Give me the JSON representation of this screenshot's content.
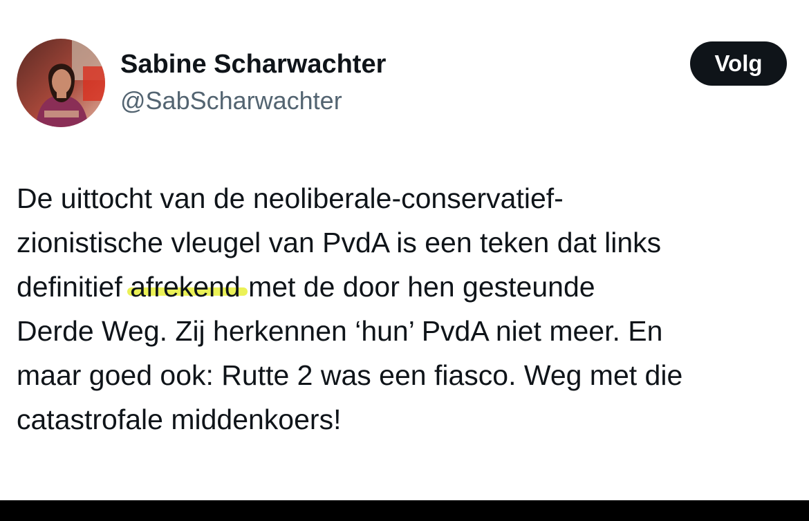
{
  "author": {
    "name": "Sabine Scharwachter",
    "handle": "@SabScharwachter"
  },
  "follow_button": {
    "label": "Volg",
    "color": "#0f1419",
    "text_color": "#ffffff"
  },
  "tweet": {
    "lines": [
      {
        "before": "De uittocht van de neoliberale-conservatief-",
        "highlight": "",
        "after": ""
      },
      {
        "before": "zionistische vleugel van PvdA is een teken dat links",
        "highlight": "",
        "after": ""
      },
      {
        "before": "definitief ",
        "highlight": "afrekend",
        "after": " met de door hen gesteunde"
      },
      {
        "before": "Derde Weg. Zij herkennen ‘hun’ PvdA niet meer. En",
        "highlight": "",
        "after": ""
      },
      {
        "before": "maar goed ook: Rutte 2 was een fiasco. Weg met die",
        "highlight": "",
        "after": ""
      },
      {
        "before": "catastrofale middenkoers!",
        "highlight": "",
        "after": ""
      }
    ],
    "highlight_color": "#e7ef3a"
  },
  "colors": {
    "text": "#0f1419",
    "handle": "#536471",
    "background": "#ffffff",
    "bottom_bar": "#000000"
  }
}
